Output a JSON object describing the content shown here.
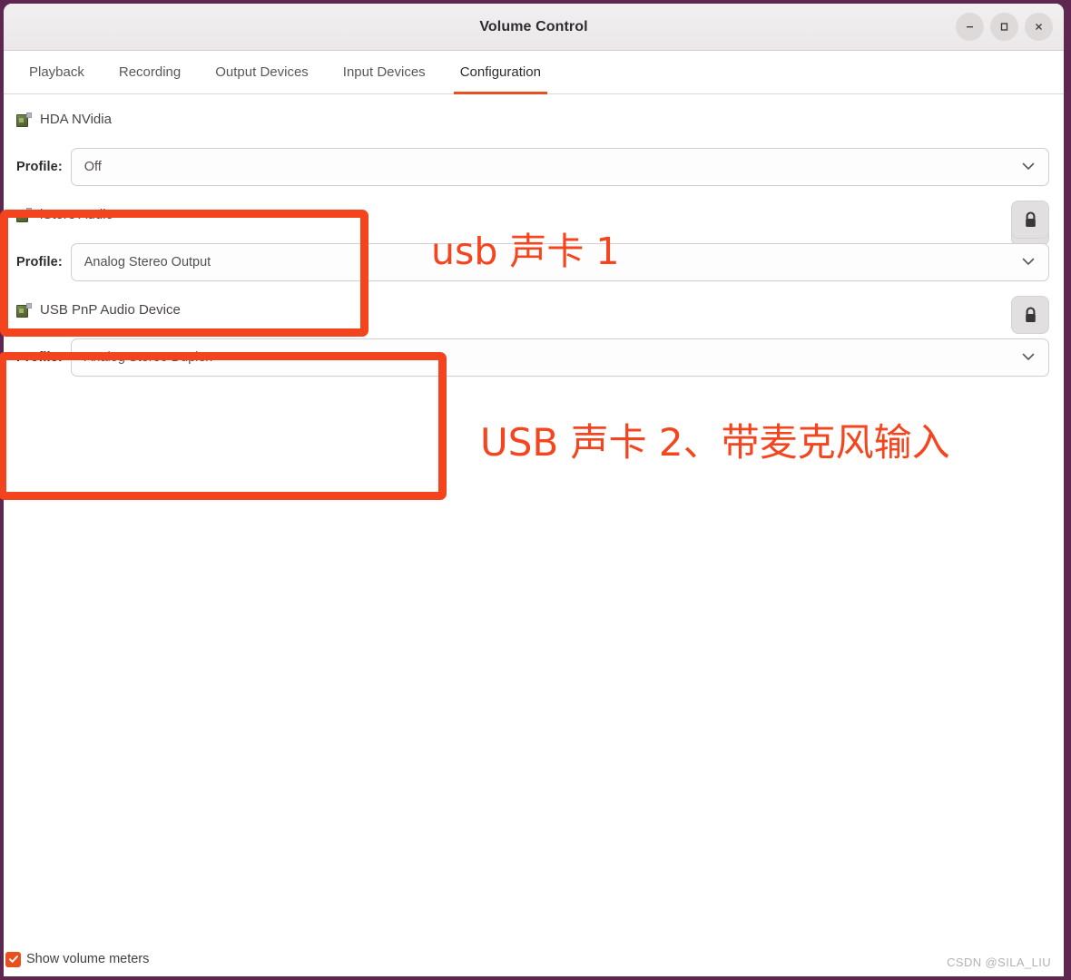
{
  "window": {
    "title": "Volume Control",
    "controls": [
      {
        "name": "minimize",
        "glyph": "–"
      },
      {
        "name": "maximize",
        "glyph": "□"
      },
      {
        "name": "close",
        "glyph": "✕"
      }
    ]
  },
  "tabs": [
    {
      "label": "Playback",
      "active": false
    },
    {
      "label": "Recording",
      "active": false
    },
    {
      "label": "Output Devices",
      "active": false
    },
    {
      "label": "Input Devices",
      "active": false
    },
    {
      "label": "Configuration",
      "active": true
    }
  ],
  "profile_label": "Profile:",
  "devices": [
    {
      "name": "HDA NVidia",
      "icon": "sound-card-icon",
      "profile": "Off",
      "lock_icon": "lock-icon"
    },
    {
      "name": "iStore Audio",
      "icon": "sound-card-icon",
      "profile": "Analog Stereo Output",
      "lock_icon": "lock-icon"
    },
    {
      "name": "USB PnP Audio Device",
      "icon": "sound-card-icon",
      "profile": "Analog Stereo Duplex",
      "lock_icon": "lock-icon"
    }
  ],
  "footer": {
    "checkbox_label": "Show volume meters",
    "checkbox_checked": true,
    "watermark": "CSDN @SILA_LIU"
  },
  "annotations": {
    "color": "#f4451e",
    "labels": [
      {
        "text": "usb 声卡 1"
      },
      {
        "text": "USB 声卡 2、带麦克风输入"
      }
    ]
  },
  "colors": {
    "accent": "#e8511f",
    "window_border": "#5d2750",
    "annotation": "#f4451e"
  }
}
